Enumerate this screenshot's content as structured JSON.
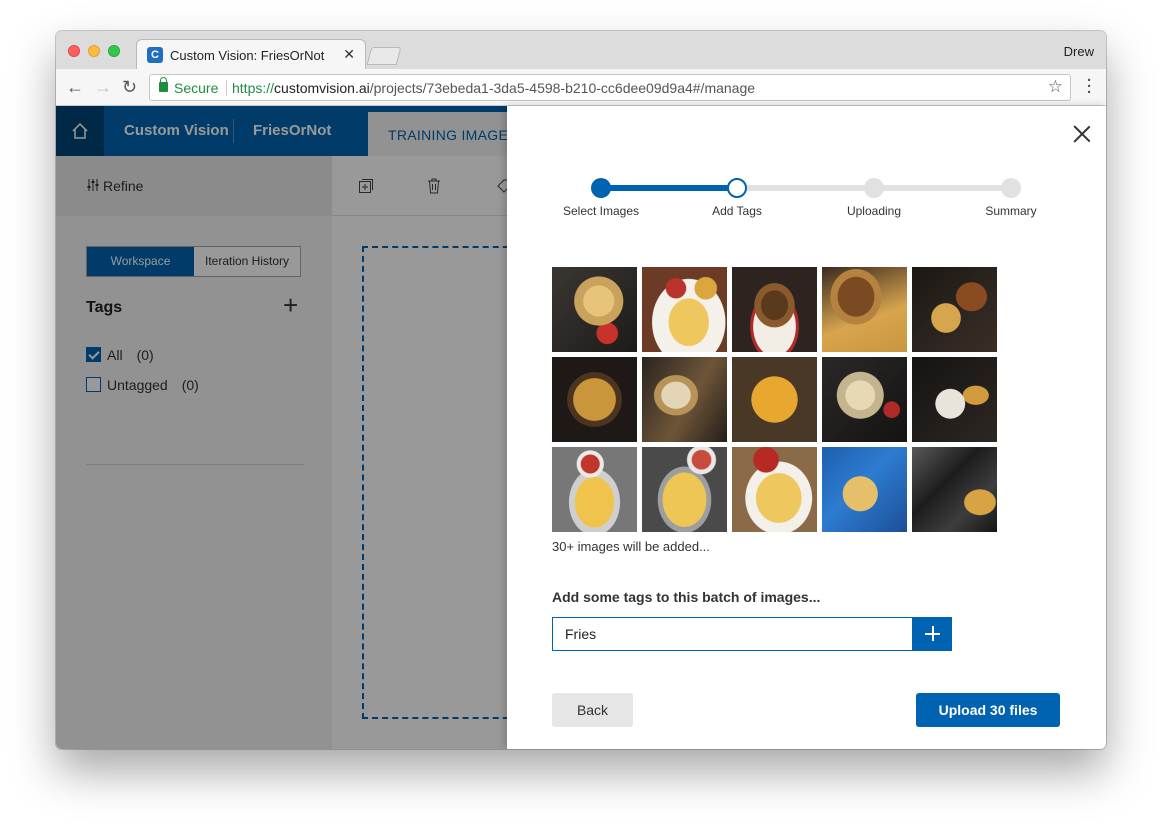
{
  "browser": {
    "tab_title": "Custom Vision: FriesOrNot",
    "profile_name": "Drew",
    "security_label": "Secure",
    "url_protocol": "https://",
    "url_host": "customvision.ai",
    "url_path": "/projects/73ebeda1-3da5-4598-b210-cc6dee09d9a4#/manage"
  },
  "app": {
    "brand": "Custom Vision",
    "project_name": "FriesOrNot",
    "active_tab": "TRAINING IMAGES",
    "accent_color": "#0063b1"
  },
  "sidebar": {
    "refine_label": "Refine",
    "segment": {
      "workspace": "Workspace",
      "iteration_history": "Iteration History",
      "selected": "Workspace"
    },
    "tags_heading": "Tags",
    "filters": [
      {
        "label": "All",
        "count": "(0)",
        "checked": true
      },
      {
        "label": "Untagged",
        "count": "(0)",
        "checked": false
      }
    ]
  },
  "dialog": {
    "steps": [
      {
        "label": "Select Images",
        "state": "done"
      },
      {
        "label": "Add Tags",
        "state": "current"
      },
      {
        "label": "Uploading",
        "state": "todo"
      },
      {
        "label": "Summary",
        "state": "todo"
      }
    ],
    "thumbnail_count": 15,
    "caption": "30+ images will be added...",
    "tag_prompt": "Add some tags to this batch of images...",
    "tag_input_value": "Fries",
    "back_label": "Back",
    "upload_label": "Upload 30 files"
  }
}
